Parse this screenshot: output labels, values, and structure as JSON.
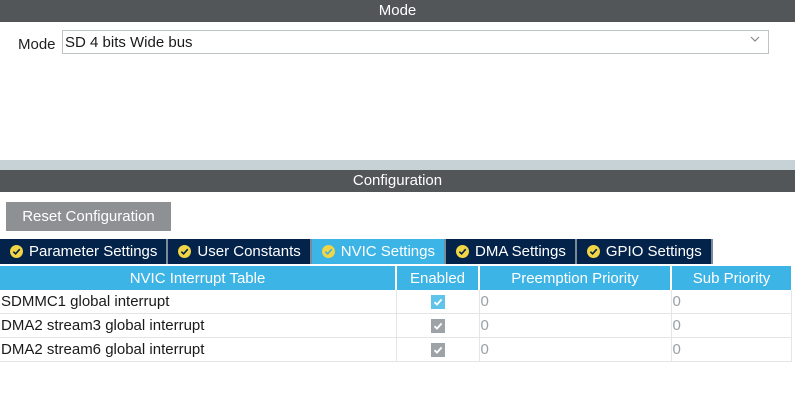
{
  "mode_section": {
    "header": "Mode",
    "mode_label": "Mode",
    "mode_value": "SD 4 bits Wide bus",
    "dropdown_icon": "chevron-down-icon"
  },
  "config_section": {
    "header": "Configuration",
    "reset_button": "Reset Configuration",
    "tabs": [
      {
        "label": "Parameter Settings",
        "icon": "check-circle-icon",
        "active": false
      },
      {
        "label": "User Constants",
        "icon": "check-circle-icon",
        "active": false
      },
      {
        "label": "NVIC Settings",
        "icon": "check-circle-icon",
        "active": true
      },
      {
        "label": "DMA Settings",
        "icon": "check-circle-icon",
        "active": false
      },
      {
        "label": "GPIO Settings",
        "icon": "check-circle-icon",
        "active": false
      }
    ],
    "table": {
      "columns": [
        "NVIC Interrupt Table",
        "Enabled",
        "Preemption Priority",
        "Sub Priority"
      ],
      "rows": [
        {
          "name": "SDMMC1 global interrupt",
          "enabled": true,
          "editable": true,
          "preemption": "0",
          "sub": "0"
        },
        {
          "name": "DMA2 stream3 global interrupt",
          "enabled": true,
          "editable": false,
          "preemption": "0",
          "sub": "0"
        },
        {
          "name": "DMA2 stream6 global interrupt",
          "enabled": true,
          "editable": false,
          "preemption": "0",
          "sub": "0"
        }
      ]
    }
  },
  "colors": {
    "header_bg": "#525659",
    "tab_bg": "#03234b",
    "accent": "#3cb4e6",
    "check_icon": "#f2d544",
    "button_bg": "#8d9194"
  }
}
